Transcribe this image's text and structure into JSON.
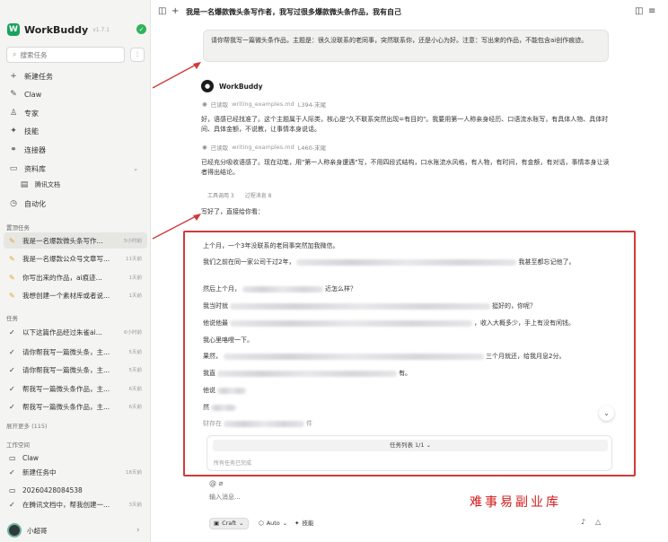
{
  "brand": {
    "name": "WorkBuddy",
    "version": "v1.7.1"
  },
  "search": {
    "placeholder": "搜索任务"
  },
  "nav": [
    {
      "label": "新建任务",
      "icon": "plus-icon"
    },
    {
      "label": "Claw",
      "icon": "claw-icon"
    },
    {
      "label": "专家",
      "icon": "expert-icon"
    },
    {
      "label": "技能",
      "icon": "skill-icon"
    },
    {
      "label": "连接器",
      "icon": "connector-icon"
    },
    {
      "label": "资料库",
      "icon": "library-icon"
    },
    {
      "label": "腾讯文档",
      "icon": "doc-icon"
    },
    {
      "label": "自动化",
      "icon": "clock-icon"
    }
  ],
  "pinned_title": "置顶任务",
  "pinned": [
    {
      "title": "我是一名爆款微头条写作...",
      "time": "5小时前"
    },
    {
      "title": "我是一名爆款公众号文章写...",
      "time": "11天前"
    },
    {
      "title": "你写出来的作品，ai痕迹...",
      "time": "1天前"
    },
    {
      "title": "我想创建一个素材库或者说...",
      "time": "1天前"
    }
  ],
  "tasks_title": "任务",
  "tasks": [
    {
      "title": "以下这篇作品经过朱雀ai...",
      "time": "6小时前"
    },
    {
      "title": "请你帮我写一篇微头条，主...",
      "time": "5天前"
    },
    {
      "title": "请你帮我写一篇微头条，主...",
      "time": "5天前"
    },
    {
      "title": "帮我写一篇微头条作品，主...",
      "time": "6天前"
    },
    {
      "title": "帮我写一篇微头条作品，主...",
      "time": "6天前"
    }
  ],
  "expand_more": "展开更多 (115)",
  "workspace_title": "工作空间",
  "workspace": [
    {
      "title": "Claw",
      "time": "",
      "icon": "folder-icon"
    },
    {
      "title": "新建任务中",
      "time": "18天前",
      "icon": "check-icon"
    },
    {
      "title": "20260428084538",
      "time": "",
      "icon": "folder-icon"
    },
    {
      "title": "在腾讯文档中，帮我创建一...",
      "time": "3天前",
      "icon": "check-icon"
    }
  ],
  "user": {
    "name": "小超哥"
  },
  "topbar": {
    "title": "我是一名爆款微头条写作者，我写过很多爆款微头条作品，我有自己"
  },
  "prompt": "请你帮我写一篇微头条作品，主题是：很久没联系的老同事，突然联系你，还是小心为好。注意：写出来的作品，不能包含ai创作痕迹。",
  "bot": {
    "name": "WorkBuddy"
  },
  "read1": {
    "label": "已读取",
    "file": "writing_examples.md",
    "range": "L394-末尾"
  },
  "para1": "好，语感已经找准了。这个主题属于人际类，核心是\"久不联系突然出现=有目的\"。我要用第一人称亲身经历、口语流水账写，有具体人物、具体时间、具体金额，不说教，让事情本身说话。",
  "read2": {
    "label": "已读取",
    "file": "writing_examples.md",
    "range": "L460-末尾"
  },
  "para2": "已经充分吸收语感了。现在动笔，用\"第一人称亲身遭遇\"写，不用四段式结构，口水账流水风格，有人物，有时间，有金额，有对话，事情本身让读者得出结论。",
  "tool_tabs": [
    "工具调用 3",
    "过程消息 8"
  ],
  "intro": "写好了，直接给你看：",
  "story": [
    {
      "a": "上个月，一个3年没联系的老同事突然加我微信。",
      "b": ""
    },
    {
      "a": "我们之前在同一家公司干过2年，",
      "b": "我甚至都忘记他了。"
    },
    {
      "a": "然后上个月，",
      "b": "近怎么样？"
    },
    {
      "a": "我当时就",
      "b": "挺好的，你呢？"
    },
    {
      "a": "他说他最",
      "b": "，收入大概多少，手上有没有闲钱。"
    },
    {
      "a": "我心里咯噔一下。",
      "b": ""
    },
    {
      "a": "果然，",
      "b": "三个月就还，给我月息2分。"
    },
    {
      "a": "我直",
      "b": "有。"
    },
    {
      "a": "他说",
      "b": ""
    },
    {
      "a": "然",
      "b": ""
    },
    {
      "a": "财存在",
      "b": "件"
    }
  ],
  "task_list": {
    "head": "任务列表 1/1",
    "done": "所有任务已完成"
  },
  "input": {
    "placeholder": "输入消息..."
  },
  "controls": {
    "craft": "Craft",
    "auto": "Auto",
    "skills": "技能"
  },
  "watermark": "难事易副业库",
  "colors": {
    "accent": "#1aa35e",
    "highlight_box": "#d23a3a"
  }
}
